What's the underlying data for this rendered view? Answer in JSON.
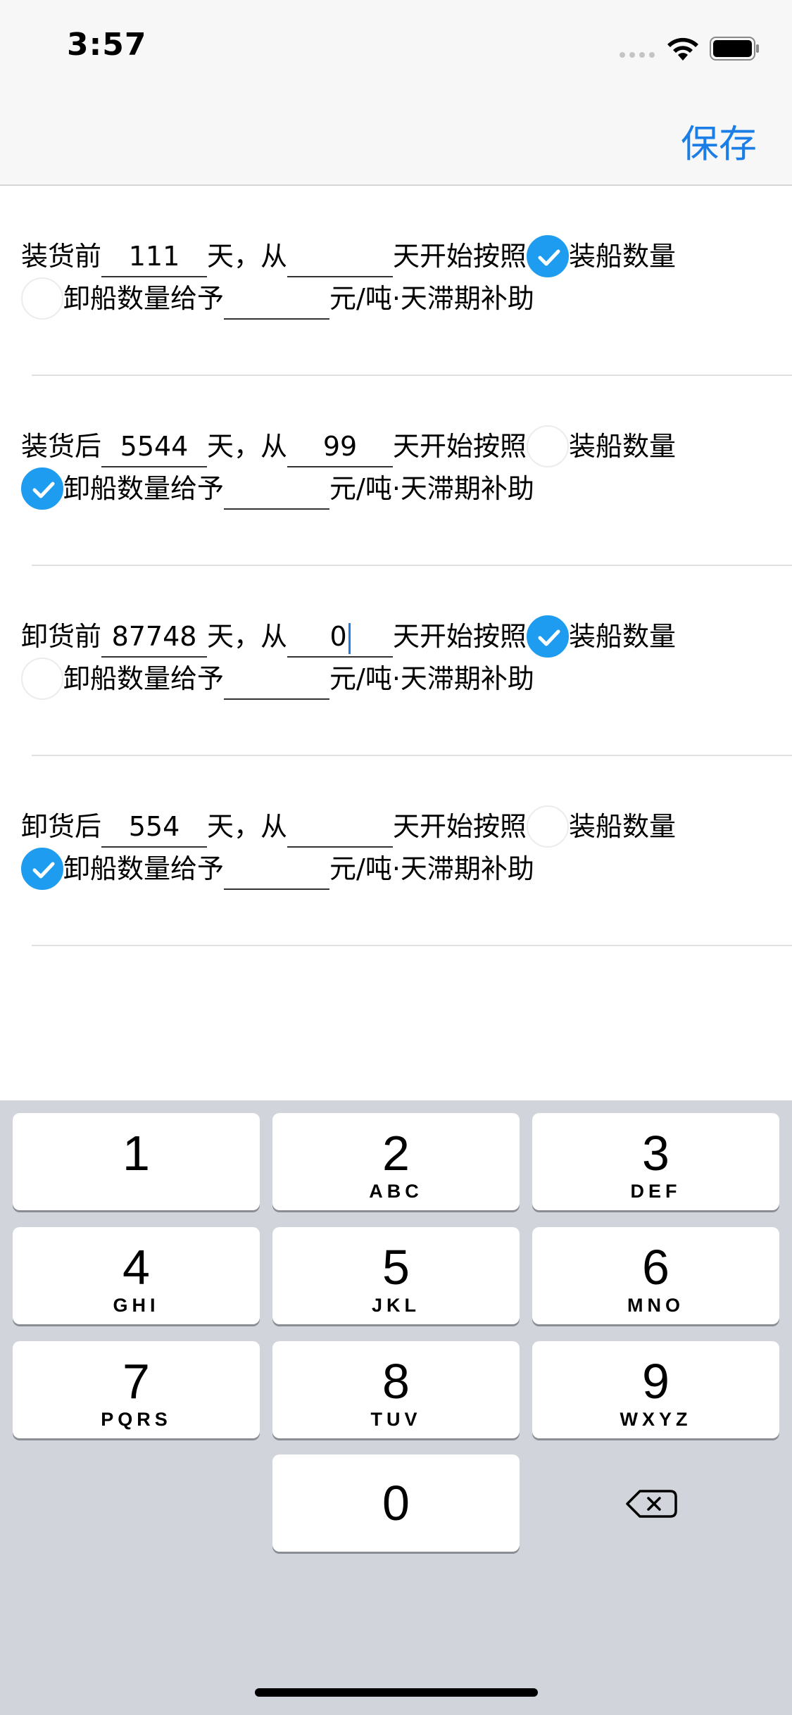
{
  "status_bar": {
    "time": "3:57"
  },
  "nav": {
    "save_label": "保存"
  },
  "rows": [
    {
      "prefix": "装货前",
      "days": "111",
      "start_days": "",
      "text_tian_cong": "天，从",
      "text_start": "天开始按照",
      "option_load": "装船数量",
      "option_unload": "卸船数量给予",
      "rate": "",
      "unit_text": "元/吨·天滞期补助",
      "selected": "load"
    },
    {
      "prefix": "装货后",
      "days": "5544",
      "start_days": "99",
      "text_tian_cong": "天，从",
      "text_start": "天开始按照",
      "option_load": "装船数量",
      "option_unload": "卸船数量给予",
      "rate": "",
      "unit_text": "元/吨·天滞期补助",
      "selected": "unload"
    },
    {
      "prefix": "卸货前",
      "days": "87748",
      "start_days": "0",
      "text_tian_cong": "天，从",
      "text_start": "天开始按照",
      "option_load": "装船数量",
      "option_unload": "卸船数量给予",
      "rate": "",
      "unit_text": "元/吨·天滞期补助",
      "selected": "load",
      "focused": "start_days"
    },
    {
      "prefix": "卸货后",
      "days": "554",
      "start_days": "",
      "text_tian_cong": "天，从",
      "text_start": "天开始按照",
      "option_load": "装船数量",
      "option_unload": "卸船数量给予",
      "rate": "",
      "unit_text": "元/吨·天滞期补助",
      "selected": "unload"
    }
  ],
  "keyboard": {
    "keys": [
      {
        "num": "1",
        "letters": ""
      },
      {
        "num": "2",
        "letters": "ABC"
      },
      {
        "num": "3",
        "letters": "DEF"
      },
      {
        "num": "4",
        "letters": "GHI"
      },
      {
        "num": "5",
        "letters": "JKL"
      },
      {
        "num": "6",
        "letters": "MNO"
      },
      {
        "num": "7",
        "letters": "PQRS"
      },
      {
        "num": "8",
        "letters": "TUV"
      },
      {
        "num": "9",
        "letters": "WXYZ"
      },
      {
        "num": "0",
        "letters": ""
      }
    ],
    "delete_icon": "backspace-icon"
  },
  "colors": {
    "accent": "#1a7ee6",
    "radio_selected": "#1e9cf0",
    "keyboard_bg": "#d1d4db"
  }
}
